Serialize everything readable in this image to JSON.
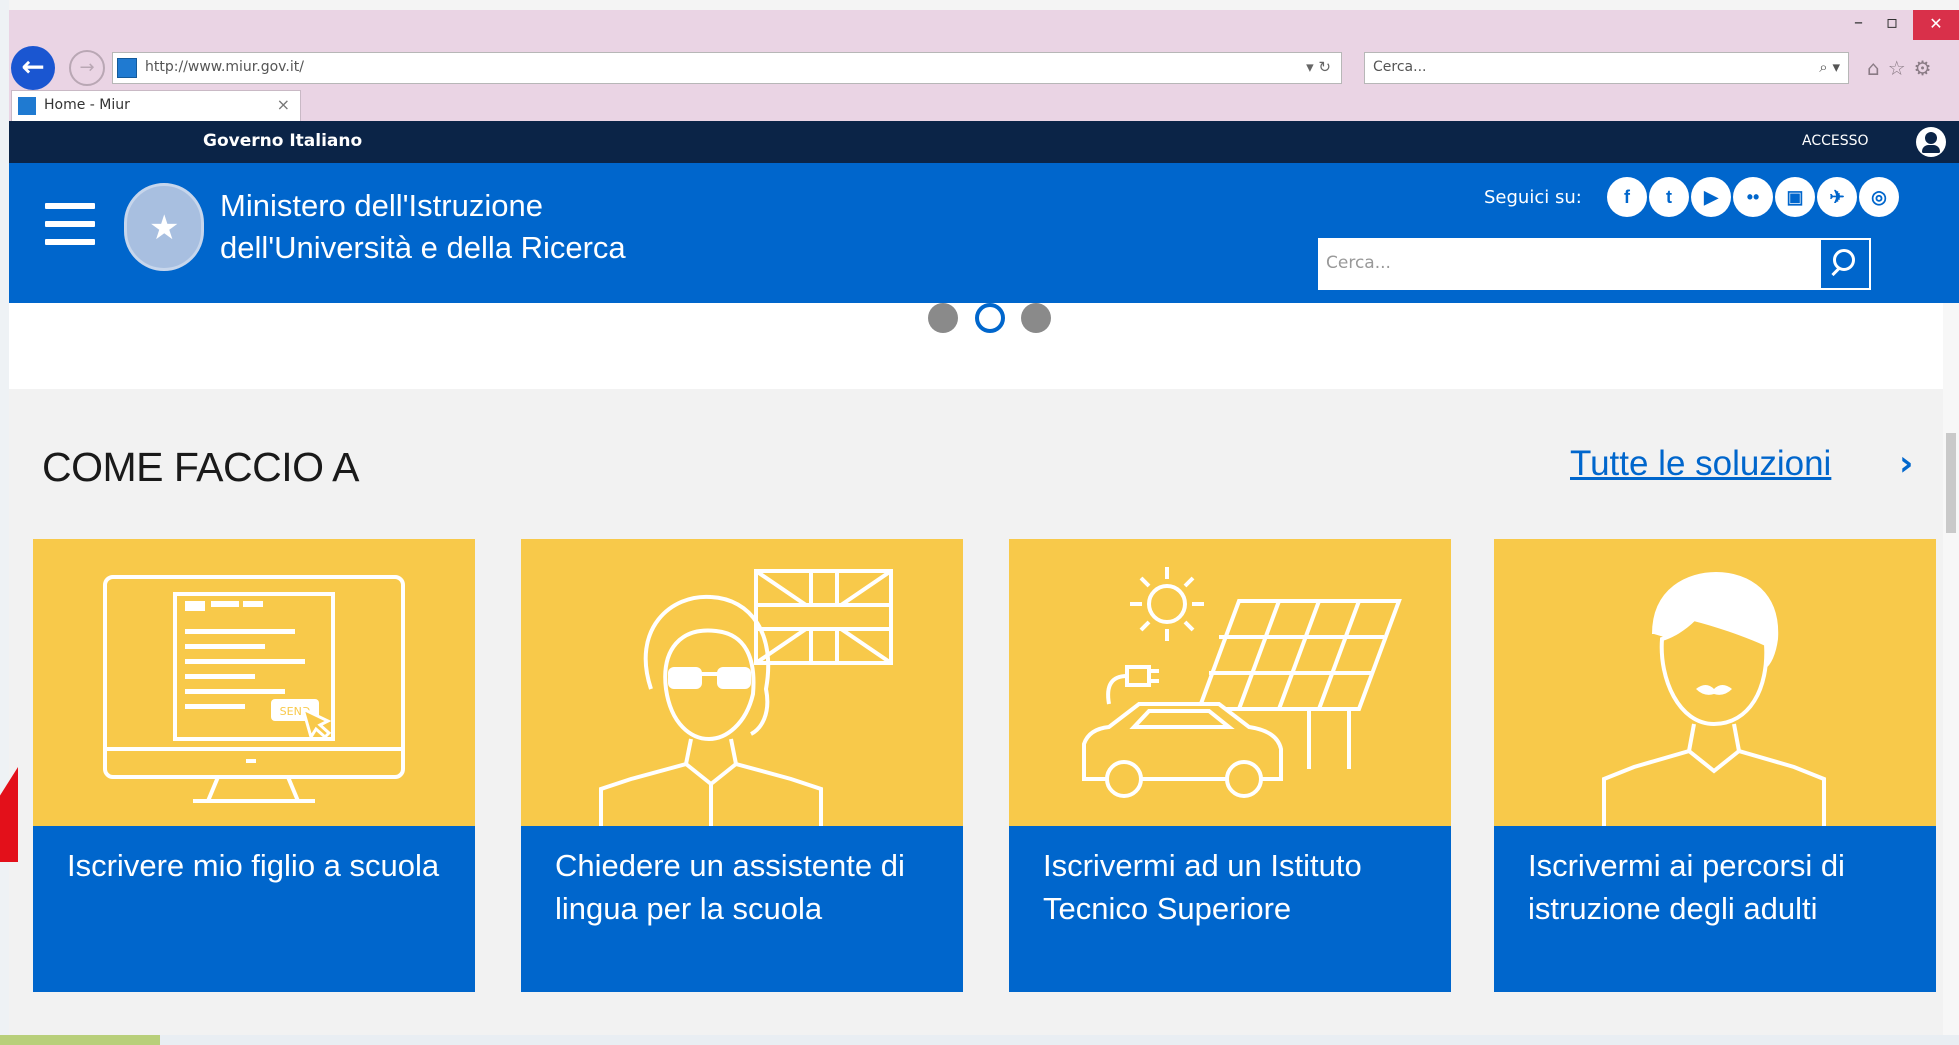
{
  "browser": {
    "url": "http://www.miur.gov.it/",
    "search_placeholder": "Cerca...",
    "tab_title": "Home - Miur",
    "window_controls": {
      "minimize": "–",
      "maximize": "▫",
      "close": "✕"
    },
    "addr_controls": "▾ ↻",
    "search_controls": "⌕ ▾",
    "toolbar_icons": "⌂☆⚙"
  },
  "gov_bar": {
    "label": "Governo Italiano",
    "access": "ACCESSO"
  },
  "header": {
    "title_line1": "Ministero dell'Istruzione",
    "title_line2": "dell'Università e della Ricerca",
    "follow_label": "Seguici su:",
    "social": [
      "f",
      "t",
      "▶",
      "••",
      "▣",
      "✈",
      "◎"
    ],
    "search_placeholder": "Cerca..."
  },
  "section": {
    "title": "COME FACCIO A",
    "all_link": "Tutte le soluzioni",
    "all_chevron": "›",
    "cards": [
      {
        "label": "Iscrivere mio figlio a scuola",
        "icon": "computer-form-icon",
        "button_text": "SEND"
      },
      {
        "label": "Chiedere un assistente di lingua per la scuola",
        "icon": "teacher-uk-flag-icon"
      },
      {
        "label": "Iscrivermi ad un Istituto Tecnico Superiore",
        "icon": "solar-car-icon"
      },
      {
        "label": "Iscrivermi ai percorsi di istruzione degli adulti",
        "icon": "adult-man-icon"
      }
    ]
  },
  "colors": {
    "primary_blue": "#0066cc",
    "dark_navy": "#0b2447",
    "card_yellow": "#f8c94a",
    "chrome_pink": "#ead4e4"
  }
}
